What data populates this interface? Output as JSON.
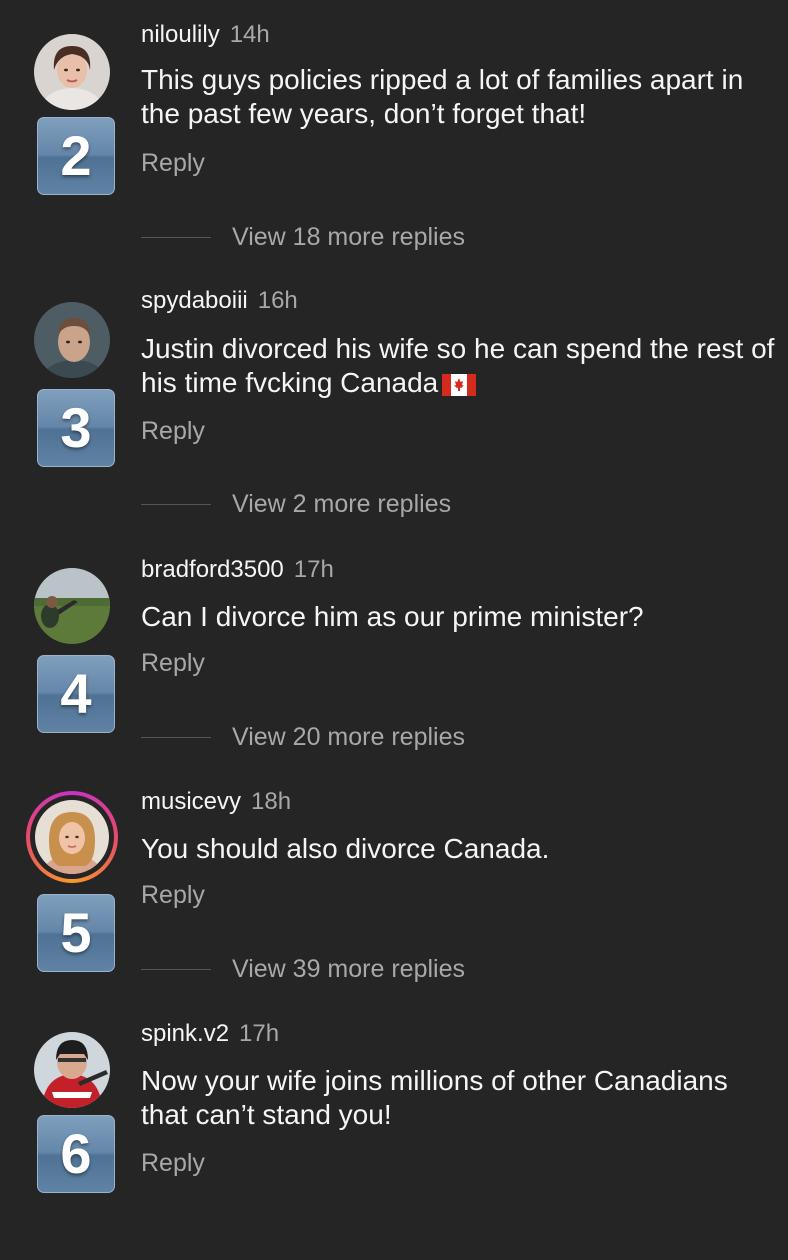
{
  "comments": [
    {
      "rank": "2",
      "username": "niloulily",
      "time": "14h",
      "text": "This guys policies ripped a lot of families apart in the past few years, don’t forget that!",
      "reply_label": "Reply",
      "view_more": "View 18 more replies"
    },
    {
      "rank": "3",
      "username": "spydaboiii",
      "time": "16h",
      "text": "Justin divorced his wife so he can spend the rest of his time fvcking Canada",
      "reply_label": "Reply",
      "view_more": "View 2 more replies"
    },
    {
      "rank": "4",
      "username": "bradford3500",
      "time": "17h",
      "text": "Can I divorce him as our prime minister?",
      "reply_label": "Reply",
      "view_more": "View 20 more replies"
    },
    {
      "rank": "5",
      "username": "musicevy",
      "time": "18h",
      "text": "You should also divorce Canada.",
      "reply_label": "Reply",
      "view_more": "View 39 more replies"
    },
    {
      "rank": "6",
      "username": "spink.v2",
      "time": "17h",
      "text": "Now your wife joins millions of other Canadians that can’t stand you!",
      "reply_label": "Reply"
    }
  ],
  "icons": {
    "canada_flag": "canada-flag-emoji"
  },
  "colors": {
    "background": "#252525",
    "secondary_text": "#a8a8a8",
    "rank_badge": "#6486a8",
    "story_ring": "#e64a6a"
  }
}
